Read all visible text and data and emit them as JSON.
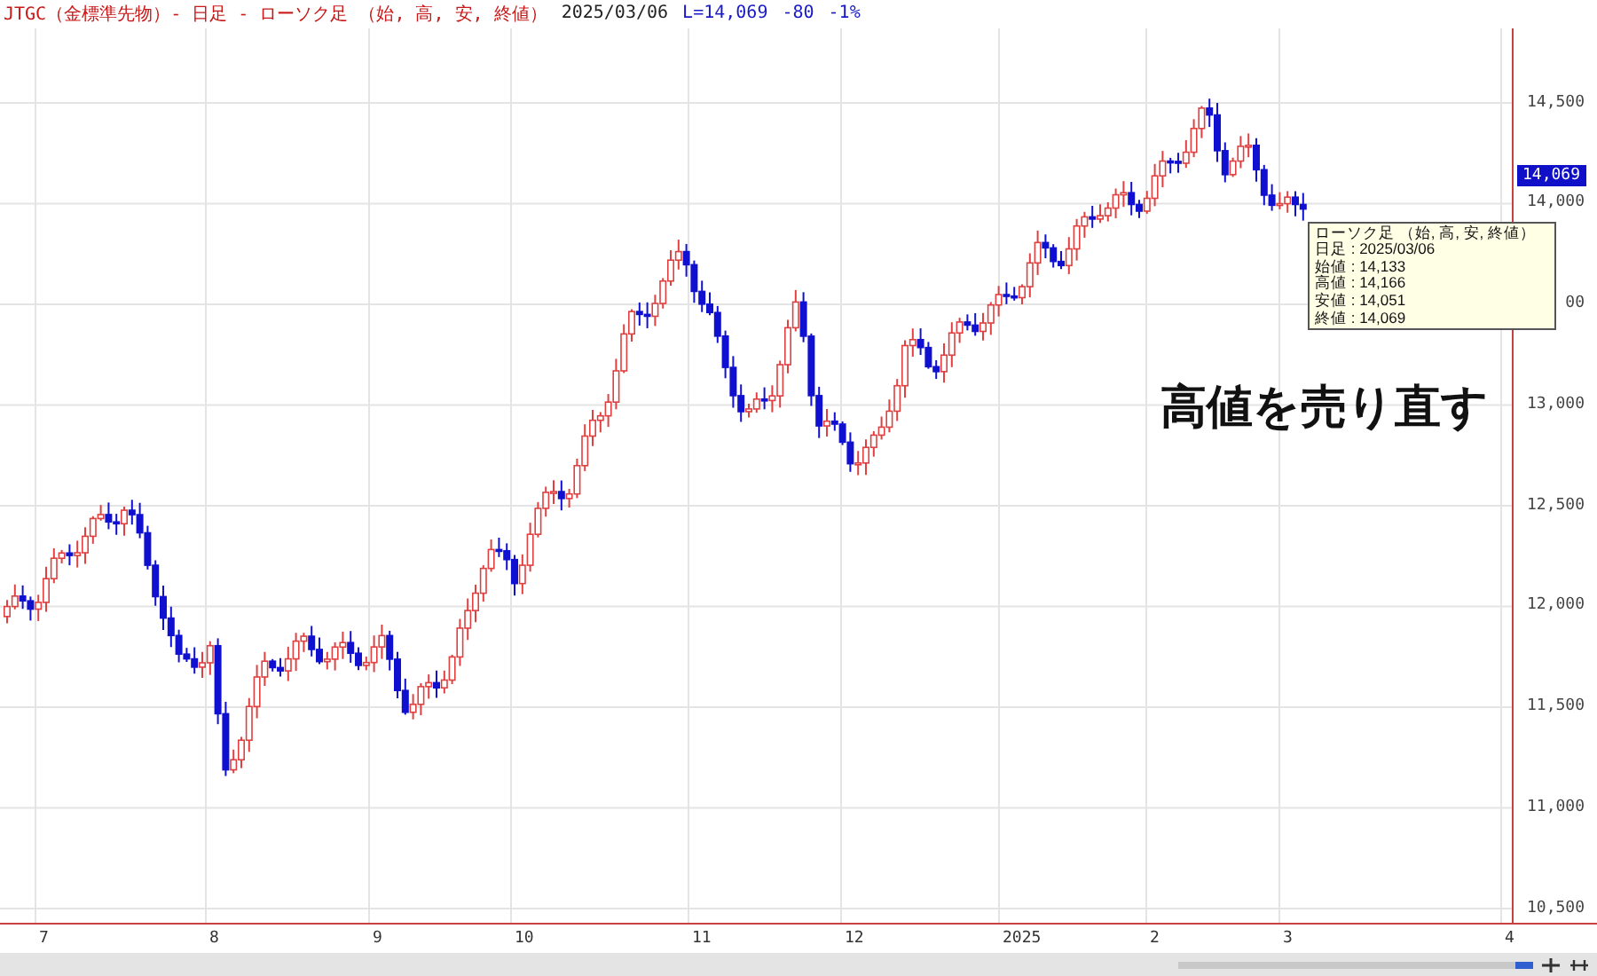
{
  "header": {
    "title": "JTGC（金標準先物）- 日足 - ローソク足 （始, 高, 安, 終値）",
    "date": "2025/03/06",
    "last": "L=14,069",
    "change": "-80",
    "change_pct": "-1%"
  },
  "price_axis": [
    "14,500",
    "14,000",
    "00",
    "13,000",
    "12,500",
    "12,000",
    "11,500",
    "11,000",
    "10,500"
  ],
  "last_price_badge": "14,069",
  "time_axis": [
    "7",
    "8",
    "9",
    "10",
    "11",
    "12",
    "2025",
    "2",
    "3",
    "4"
  ],
  "tooltip": {
    "title": "ローソク足 （始, 高, 安, 終値）",
    "rows": [
      "日足 : 2025/03/06",
      "始値 : 14,133",
      "高値 : 14,166",
      "安値 : 14,051",
      "終値 : 14,069"
    ]
  },
  "annotation": "高値を売り直す"
}
